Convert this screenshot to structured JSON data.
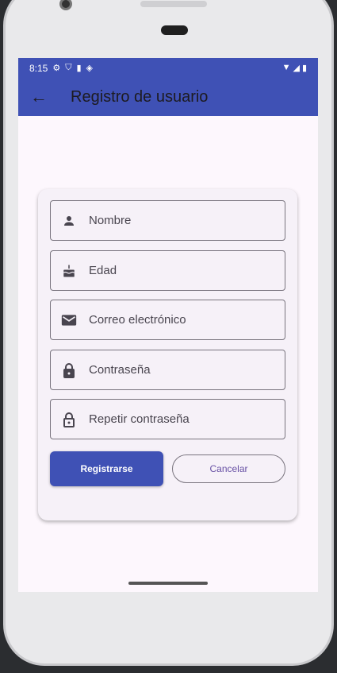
{
  "status_bar": {
    "time": "8:15",
    "icons": [
      "settings-icon",
      "shield-icon",
      "sd-card-icon",
      "vpn-icon",
      "wifi-icon",
      "signal-icon",
      "battery-icon"
    ]
  },
  "app_bar": {
    "title": "Registro de usuario",
    "back_icon": "arrow-back-icon"
  },
  "form": {
    "fields": [
      {
        "label": "Nombre",
        "icon": "person-icon"
      },
      {
        "label": "Edad",
        "icon": "cake-icon"
      },
      {
        "label": "Correo electrónico",
        "icon": "email-icon"
      },
      {
        "label": "Contraseña",
        "icon": "lock-icon"
      },
      {
        "label": "Repetir contraseña",
        "icon": "lock-outline-icon"
      }
    ],
    "register_label": "Registrarse",
    "cancel_label": "Cancelar"
  },
  "colors": {
    "primary": "#3f51b5",
    "accent_text": "#6750a4",
    "background": "#fdf7fd"
  }
}
